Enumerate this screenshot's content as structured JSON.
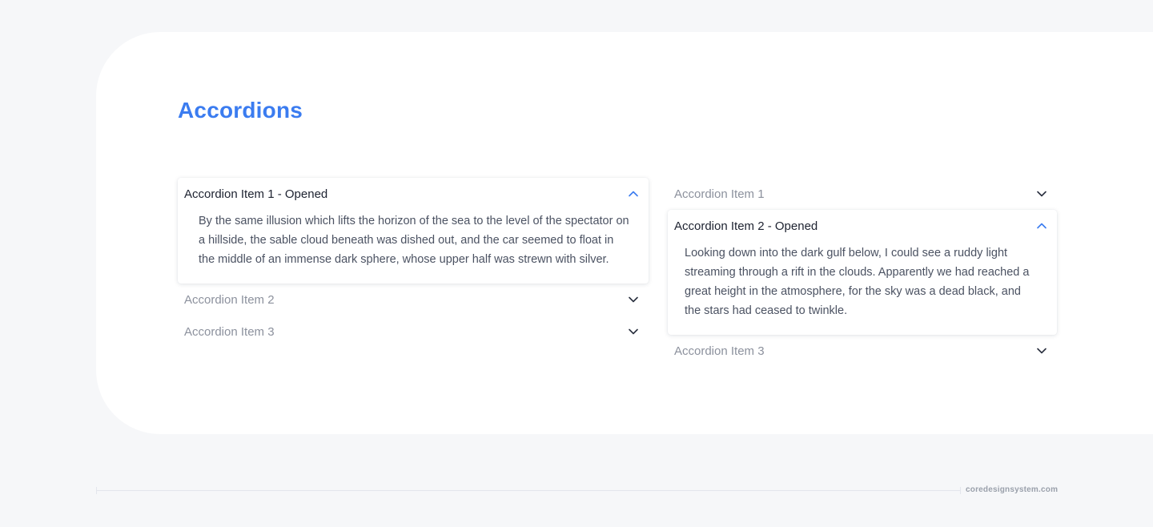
{
  "page": {
    "title": "Accordions",
    "footer": "coredesignsystem.com"
  },
  "left_accordion": {
    "items": [
      {
        "label": "Accordion Item 1 - Opened",
        "open": true,
        "body": "By the same illusion which lifts the horizon of the sea to the level of the spectator on a hillside, the sable cloud beneath was dished out, and the car seemed to float in the middle of an immense dark sphere, whose upper half was strewn with silver."
      },
      {
        "label": "Accordion Item 2",
        "open": false
      },
      {
        "label": "Accordion Item 3",
        "open": false
      }
    ]
  },
  "right_accordion": {
    "items": [
      {
        "label": "Accordion Item 1",
        "open": false
      },
      {
        "label": "Accordion Item 2 - Opened",
        "open": true,
        "body": "Looking down into the dark gulf below, I could see a ruddy light streaming through a rift in the clouds. Apparently we had reached a great height in the atmosphere, for the sky was a dead black, and the stars had ceased to twinkle."
      },
      {
        "label": "Accordion Item 3",
        "open": false
      }
    ]
  },
  "icons": {
    "expanded": "chevron-up-icon",
    "collapsed": "chevron-down-icon"
  },
  "colors": {
    "accent": "#3b7cf0",
    "text_dark": "#1d2230",
    "text_muted": "#8c919d",
    "body_text": "#4b5262",
    "background": "#f6f7f9"
  }
}
